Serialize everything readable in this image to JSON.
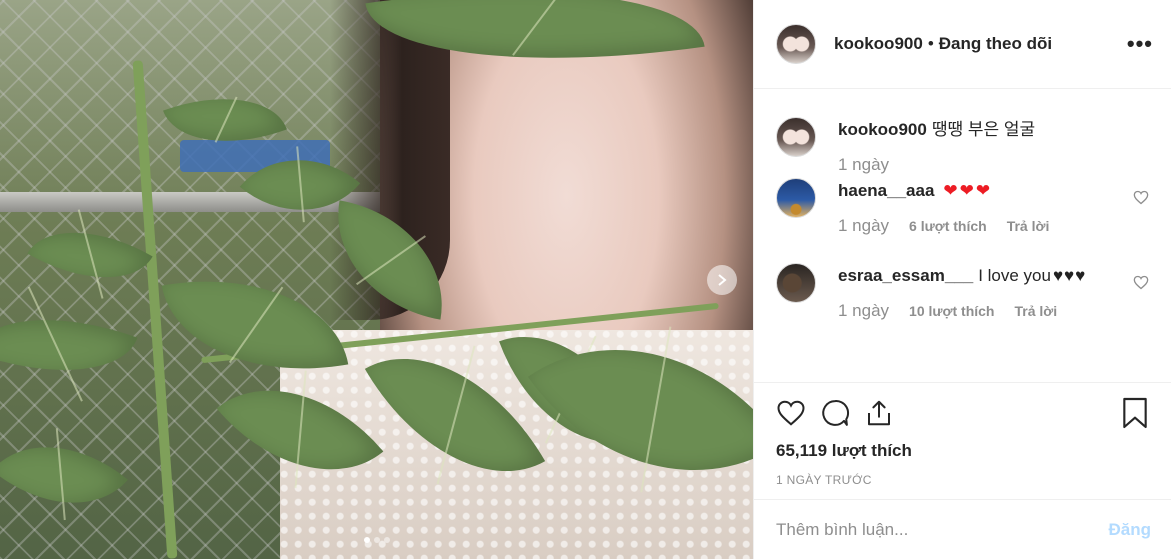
{
  "post": {
    "username": "kookoo900",
    "separator": "•",
    "follow_label": "Đang theo dõi",
    "more_label": "•••"
  },
  "comments": [
    {
      "username": "kookoo900",
      "text": "땡땡 부은 얼굴",
      "time": "1 ngày",
      "avatar": "profile-photo"
    },
    {
      "username": "haena__aaa",
      "text": "",
      "emoji": "❤❤❤",
      "time": "1 ngày",
      "likes": "6 lượt thích",
      "reply": "Trả lời",
      "avatar": "eiffel-tower-photo"
    },
    {
      "username": "esraa_essam___",
      "text": "I love you",
      "emoji": "♥♥♥",
      "time": "1 ngày",
      "likes": "10 lượt thích",
      "reply": "Trả lời",
      "avatar": "dark-photo"
    }
  ],
  "actions": {
    "icons": [
      "heart-icon",
      "comment-icon",
      "share-icon",
      "bookmark-icon"
    ],
    "like_count": "65,119 lượt thích",
    "time_ago": "1 NGÀY TRƯỚC"
  },
  "composer": {
    "placeholder": "Thêm bình luận...",
    "post_label": "Đăng"
  },
  "carousel": {
    "dot_count": 3,
    "active_index": 0
  },
  "colors": {
    "text": "#262626",
    "muted": "#8e8e8e",
    "border": "#efefef",
    "post_disabled": "#b3dbff",
    "heart_red": "#ed1c24"
  }
}
